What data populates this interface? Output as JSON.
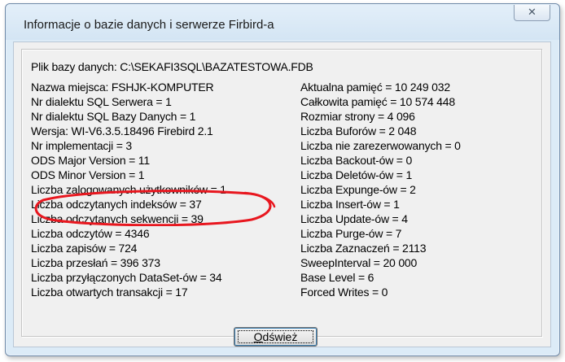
{
  "window": {
    "title": "Informacje o bazie danych i serwerze Firbird-a",
    "close_glyph": "✕"
  },
  "file_line": "Plik bazy danych:  C:\\SEKAFI3SQL\\BAZATESTOWA.FDB",
  "left_column": [
    "Nazwa miejsca:  FSHJK-KOMPUTER",
    "Nr dialektu SQL Serwera = 1",
    "Nr dialektu SQL Bazy Danych = 1",
    "Wersja: WI-V6.3.5.18496 Firebird 2.1",
    "Nr implementacji = 3",
    "ODS Major Version = 11",
    "ODS Minor Version = 1",
    "Liczba zalogowanych użytkowników = 1",
    "Liczba odczytanych indeksów = 37",
    "Liczba odczytanych sekwencji = 39",
    "Liczba odczytów = 4346",
    "Liczba zapisów = 724",
    "Liczba przesłań =    396 373",
    "Liczba przyłączonych DataSet-ów = 34",
    "Liczba otwartych transakcji = 17"
  ],
  "right_column": [
    "Aktualna pamięć = 10 249 032",
    "Całkowita pamięć = 10 574 448",
    "Rozmiar strony =     4 096",
    "Liczba Buforów =     2 048",
    "Liczba nie zarezerwowanych = 0",
    "Liczba Backout-ów = 0",
    "Liczba Deletów-ów = 1",
    "Liczba Expunge-ów = 2",
    "Liczba Insert-ów = 1",
    "Liczba Update-ów = 4",
    "Liczba Purge-ów = 7",
    "Liczba Zaznaczeń = 2113",
    "SweepInterval =     20 000",
    "Base Level = 6",
    "Forced Writes = 0"
  ],
  "refresh_button": {
    "label": "Odśwież",
    "mnemonic": "O",
    "rest": "dśwież"
  },
  "colors": {
    "annotation": "#e8171f"
  }
}
